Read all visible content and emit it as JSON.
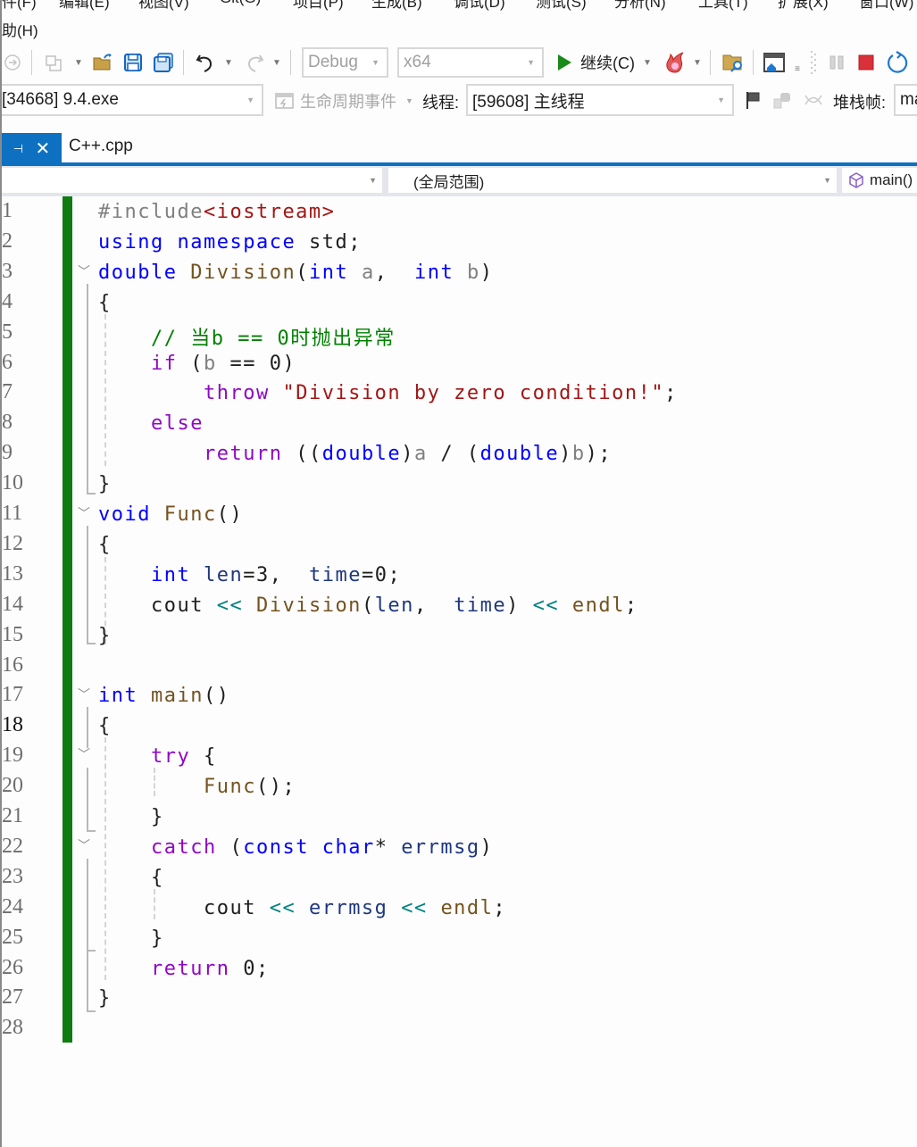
{
  "menu": {
    "items": [
      "件(F)",
      "编辑(E)",
      "视图(V)",
      "Git(G)",
      "项目(P)",
      "生成(B)",
      "调试(D)",
      "测试(S)",
      "分析(N)",
      "工具(T)",
      "扩展(X)",
      "窗口(W)"
    ],
    "help": "助(H)"
  },
  "toolbar": {
    "config": "Debug",
    "platform": "x64",
    "continue_label": "继续(C)",
    "icons": [
      "navigate-back-icon",
      "new-project-icon",
      "open-folder-icon",
      "save-icon",
      "save-all-icon",
      "undo-icon",
      "redo-icon",
      "continue-icon",
      "hot-reload-icon",
      "find-in-files-icon",
      "browser-icon",
      "pause-icon",
      "stop-icon",
      "restart-icon"
    ],
    "colors": {
      "continue": "#1a8a1a",
      "stop": "#d9313a",
      "restart": "#1e78d0"
    }
  },
  "debugbar": {
    "process": "[34668] 9.4.exe",
    "lifecycle": "生命周期事件",
    "thread_label": "线程:",
    "thread": "[59608] 主线程",
    "stackframe_label": "堆栈帧:",
    "stackframe": "ma"
  },
  "tabs": [
    {
      "title": "C++.cpp",
      "active": true
    }
  ],
  "navbar": {
    "scope": "(全局范围)",
    "member": "main()"
  },
  "editor": {
    "current_line": 18,
    "accent": "#107c10",
    "lines": [
      "#include<iostream>",
      "using namespace std;",
      "double Division(int a,  int b)",
      "{",
      "    // 当b == 0时抛出异常",
      "    if (b == 0)",
      "        throw \"Division by zero condition!\";",
      "    else",
      "        return ((double)a / (double)b);",
      "}",
      "void Func()",
      "{",
      "    int len=3,  time=0;",
      "    cout << Division(len,  time) << endl;",
      "}",
      "",
      "int main()",
      "{",
      "    try {",
      "        Func();",
      "    }",
      "    catch (const char* errmsg)",
      "    {",
      "        cout << errmsg << endl;",
      "    }",
      "    return 0;",
      "}",
      ""
    ]
  }
}
